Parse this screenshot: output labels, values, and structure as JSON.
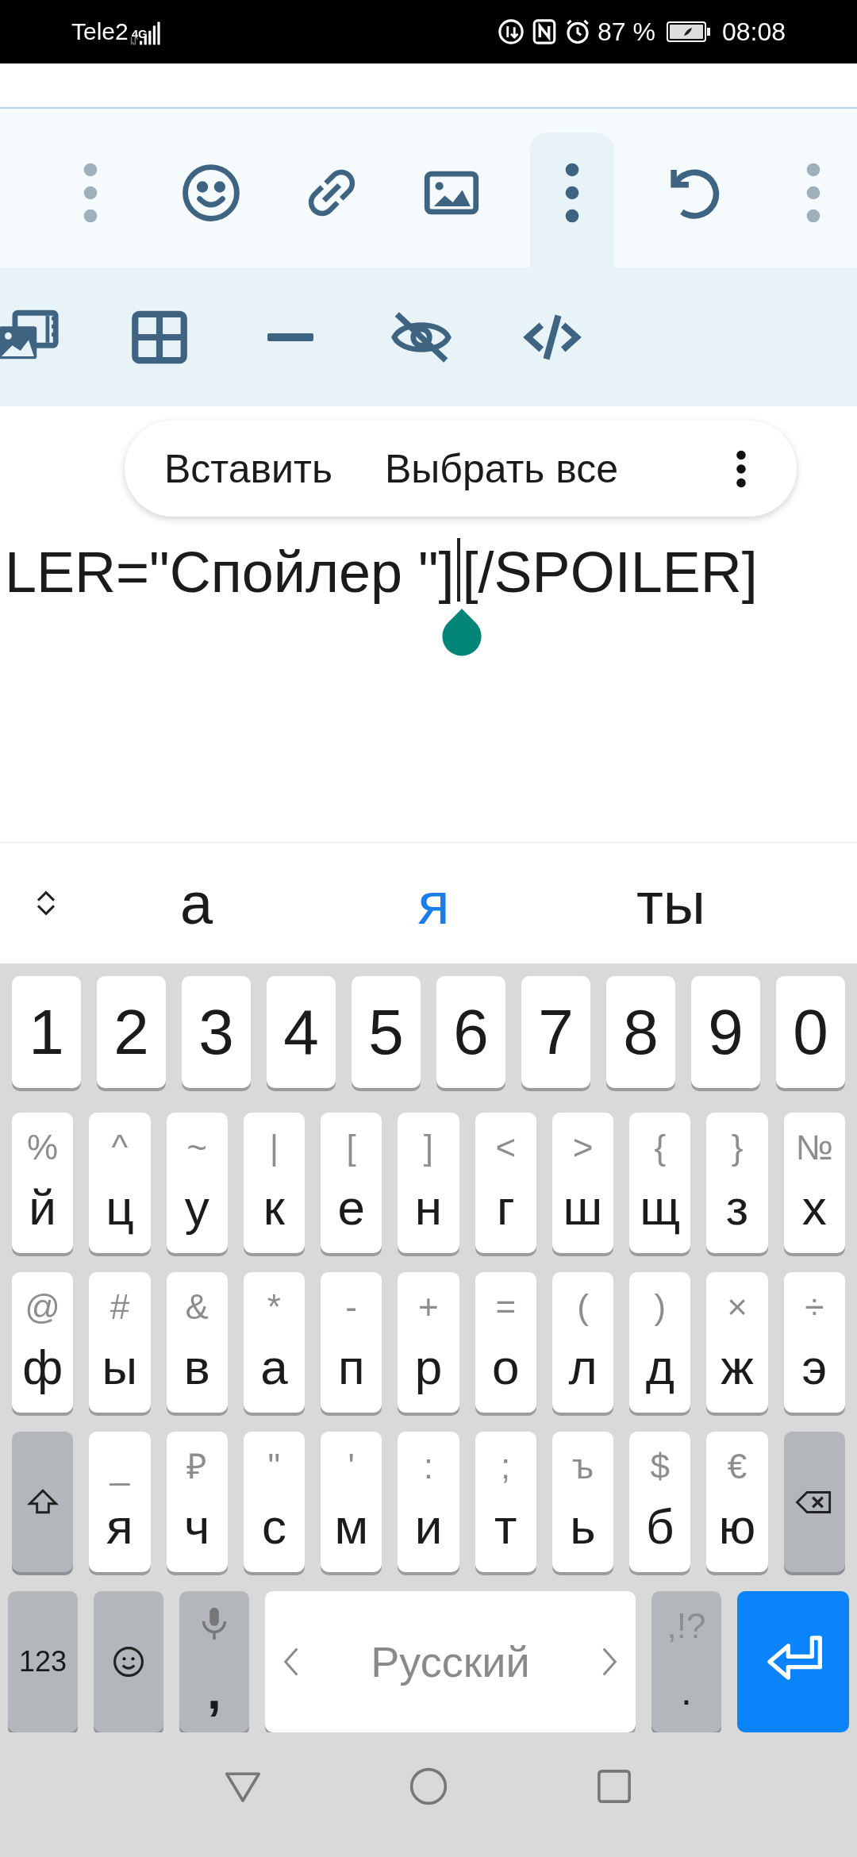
{
  "status_bar": {
    "carrier": "Tele2",
    "network": "4G",
    "battery": "87 %",
    "time": "08:08"
  },
  "toolbar": {
    "rows": [
      {
        "items": [
          {
            "kind": "more",
            "selected": false
          },
          {
            "kind": "emoji",
            "selected": false
          },
          {
            "kind": "link",
            "selected": false
          },
          {
            "kind": "image",
            "selected": false
          },
          {
            "kind": "more",
            "selected": true
          },
          {
            "kind": "undo",
            "selected": false
          },
          {
            "kind": "more",
            "selected": false
          }
        ]
      },
      {
        "items": [
          {
            "kind": "media"
          },
          {
            "kind": "table"
          },
          {
            "kind": "rule"
          },
          {
            "kind": "hide"
          },
          {
            "kind": "code"
          }
        ]
      }
    ]
  },
  "context_menu": {
    "items": [
      "Вставить",
      "Выбрать все"
    ]
  },
  "editor": {
    "text_before_cursor": "LER=\"Спойлер \"]",
    "text_after_cursor": "[/SPOILER]"
  },
  "suggestions": [
    {
      "text": "а",
      "selected": false
    },
    {
      "text": "я",
      "selected": true
    },
    {
      "text": "ты",
      "selected": false
    }
  ],
  "keyboard": {
    "number_row": [
      "1",
      "2",
      "3",
      "4",
      "5",
      "6",
      "7",
      "8",
      "9",
      "0"
    ],
    "rows": [
      {
        "keys": [
          {
            "kind": "letter",
            "hint": "%",
            "label": "й"
          },
          {
            "kind": "letter",
            "hint": "^",
            "label": "ц"
          },
          {
            "kind": "letter",
            "hint": "~",
            "label": "у"
          },
          {
            "kind": "letter",
            "hint": "|",
            "label": "к"
          },
          {
            "kind": "letter",
            "hint": "[",
            "label": "е"
          },
          {
            "kind": "letter",
            "hint": "]",
            "label": "н"
          },
          {
            "kind": "letter",
            "hint": "<",
            "label": "г"
          },
          {
            "kind": "letter",
            "hint": ">",
            "label": "ш"
          },
          {
            "kind": "letter",
            "hint": "{",
            "label": "щ"
          },
          {
            "kind": "letter",
            "hint": "}",
            "label": "з"
          },
          {
            "kind": "letter",
            "hint": "№",
            "label": "х"
          }
        ]
      },
      {
        "keys": [
          {
            "kind": "letter",
            "hint": "@",
            "label": "ф"
          },
          {
            "kind": "letter",
            "hint": "#",
            "label": "ы"
          },
          {
            "kind": "letter",
            "hint": "&",
            "label": "в"
          },
          {
            "kind": "letter",
            "hint": "*",
            "label": "а"
          },
          {
            "kind": "letter",
            "hint": "-",
            "label": "п"
          },
          {
            "kind": "letter",
            "hint": "+",
            "label": "р"
          },
          {
            "kind": "letter",
            "hint": "=",
            "label": "о"
          },
          {
            "kind": "letter",
            "hint": "(",
            "label": "л"
          },
          {
            "kind": "letter",
            "hint": ")",
            "label": "д"
          },
          {
            "kind": "letter",
            "hint": "×",
            "label": "ж"
          },
          {
            "kind": "letter",
            "hint": "÷",
            "label": "э"
          }
        ]
      },
      {
        "keys": [
          {
            "kind": "shift"
          },
          {
            "kind": "letter",
            "hint": "_",
            "label": "я"
          },
          {
            "kind": "letter",
            "hint": "₽",
            "label": "ч"
          },
          {
            "kind": "letter",
            "hint": "\"",
            "label": "с"
          },
          {
            "kind": "letter",
            "hint": "'",
            "label": "м"
          },
          {
            "kind": "letter",
            "hint": ":",
            "label": "и"
          },
          {
            "kind": "letter",
            "hint": ";",
            "label": "т"
          },
          {
            "kind": "letter",
            "hint": "ъ",
            "label": "ь"
          },
          {
            "kind": "letter",
            "hint": "$",
            "label": "б"
          },
          {
            "kind": "letter",
            "hint": "€",
            "label": "ю"
          },
          {
            "kind": "backspace"
          }
        ]
      }
    ],
    "bottom_row": [
      {
        "kind": "symbols",
        "label": "123"
      },
      {
        "kind": "emoji"
      },
      {
        "kind": "mic",
        "label": ","
      },
      {
        "kind": "space",
        "label": "Русский"
      },
      {
        "kind": "punct",
        "hint": ",!?",
        "label": "."
      },
      {
        "kind": "enter"
      }
    ]
  }
}
